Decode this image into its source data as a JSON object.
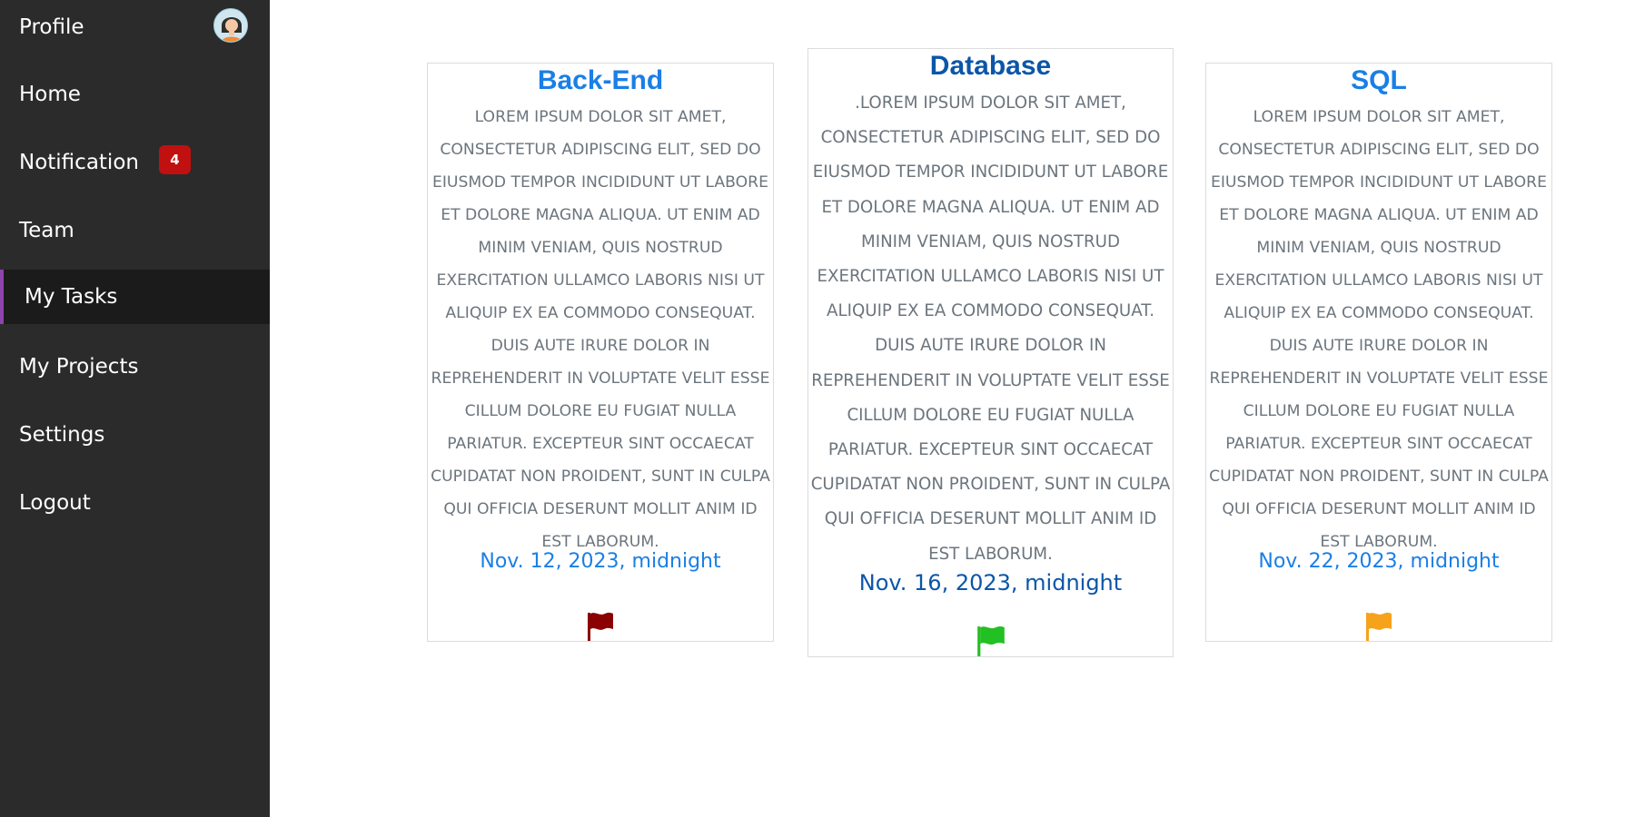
{
  "sidebar": {
    "items": [
      {
        "label": "Profile"
      },
      {
        "label": "Home"
      },
      {
        "label": "Notification",
        "badge": "4"
      },
      {
        "label": "Team"
      },
      {
        "label": "My Tasks",
        "active": true
      },
      {
        "label": "My Projects"
      },
      {
        "label": "Settings"
      },
      {
        "label": "Logout"
      }
    ],
    "avatar_icon": "user-avatar-icon",
    "active_accent": "#8e44ad",
    "badge_color": "#c01010"
  },
  "cards": [
    {
      "title": "Back-End",
      "title_color": "#1a7fe6",
      "description": "Lorem ipsum dolor sit amet, consectetur adipiscing elit, sed do eiusmod tempor incididunt ut labore et dolore magna aliqua. Ut enim ad minim veniam, quis nostrud exercitation ullamco laboris nisi ut aliquip ex ea commodo consequat. Duis aute irure dolor in reprehenderit in voluptate velit esse cillum dolore eu fugiat nulla pariatur. Excepteur sint occaecat cupidatat non proident, sunt in culpa qui officia deserunt mollit anim id est laborum.",
      "date": "Nov. 12, 2023, midnight",
      "flag_icon": "flag-icon",
      "flag_color": "#8b0000"
    },
    {
      "title": "Database",
      "title_color": "#0b56a8",
      "description": ".Lorem ipsum dolor sit amet, consectetur adipiscing elit, sed do eiusmod tempor incididunt ut labore et dolore magna aliqua. Ut enim ad minim veniam, quis nostrud exercitation ullamco laboris nisi ut aliquip ex ea commodo consequat. Duis aute irure dolor in reprehenderit in voluptate velit esse cillum dolore eu fugiat nulla pariatur. Excepteur sint occaecat cupidatat non proident, sunt in culpa qui officia deserunt mollit anim id est laborum.",
      "date": "Nov. 16, 2023, midnight",
      "flag_icon": "flag-icon",
      "flag_color": "#22c022"
    },
    {
      "title": "SQL",
      "title_color": "#1a7fe6",
      "description": "Lorem ipsum dolor sit amet, consectetur adipiscing elit, sed do eiusmod tempor incididunt ut labore et dolore magna aliqua. Ut enim ad minim veniam, quis nostrud exercitation ullamco laboris nisi ut aliquip ex ea commodo consequat. Duis aute irure dolor in reprehenderit in voluptate velit esse cillum dolore eu fugiat nulla pariatur. Excepteur sint occaecat cupidatat non proident, sunt in culpa qui officia deserunt mollit anim id est laborum.",
      "date": "Nov. 22, 2023, midnight",
      "flag_icon": "flag-icon",
      "flag_color": "#f7a21b"
    }
  ]
}
